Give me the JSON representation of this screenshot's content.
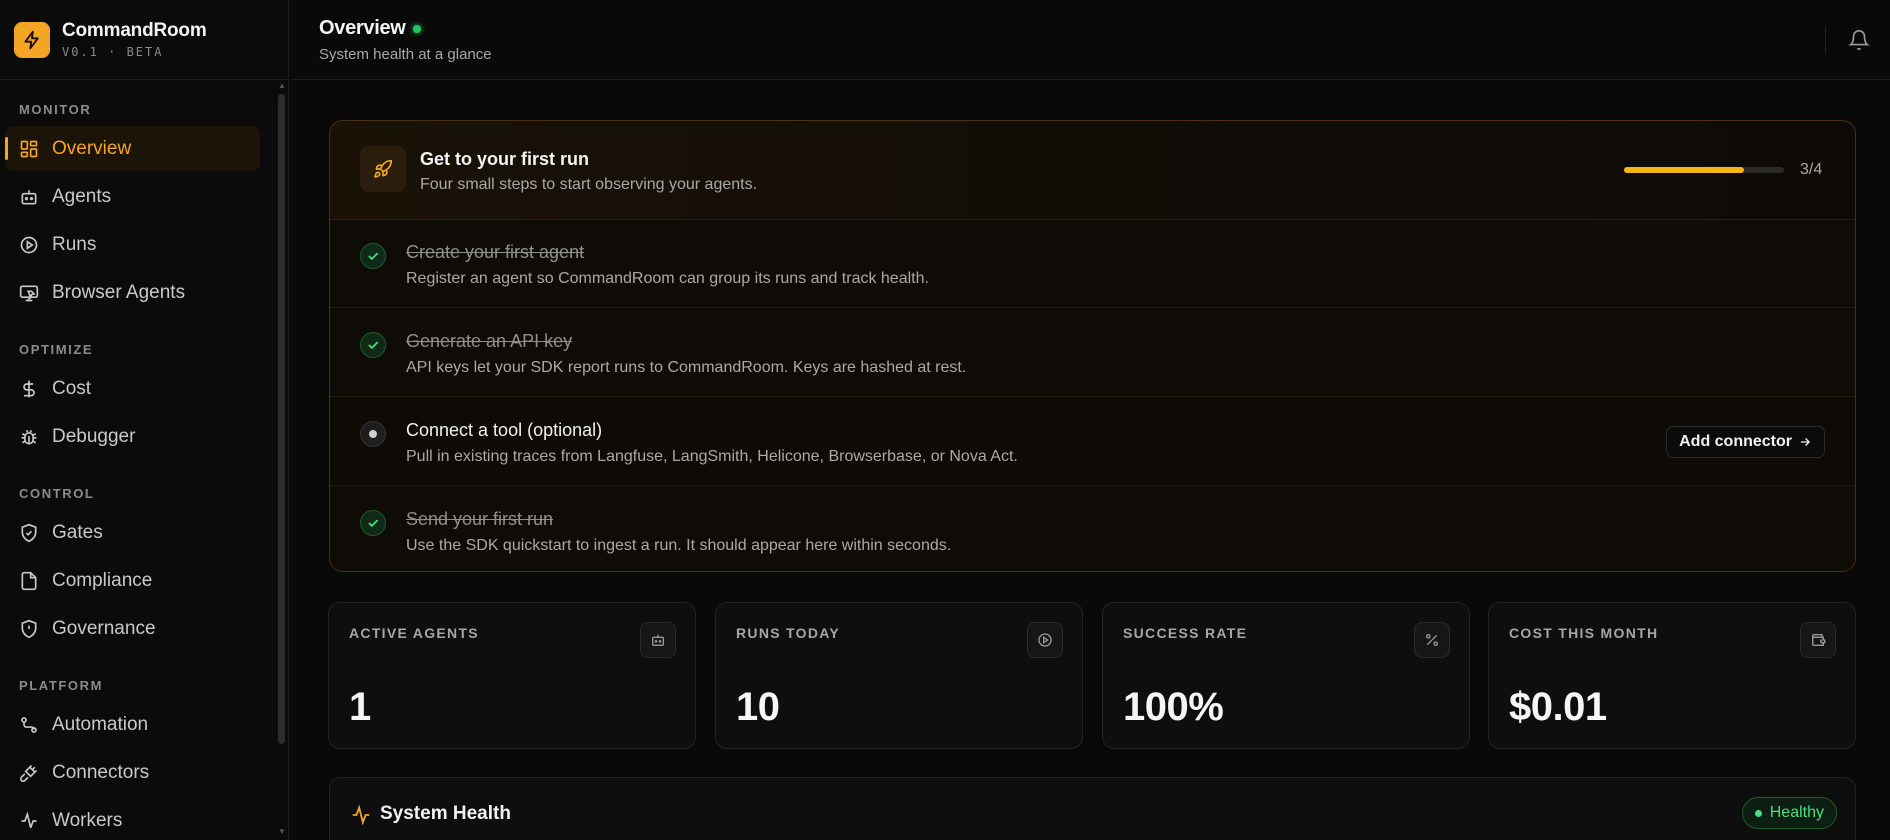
{
  "app": {
    "name": "CommandRoom",
    "version": "V0.1 · BETA"
  },
  "sidebar": {
    "sections": [
      {
        "label": "MONITOR",
        "items": [
          {
            "label": "Overview",
            "icon": "dashboard-icon",
            "active": true
          },
          {
            "label": "Agents",
            "icon": "bot-icon"
          },
          {
            "label": "Runs",
            "icon": "play-circle-icon"
          },
          {
            "label": "Browser Agents",
            "icon": "browser-icon"
          }
        ]
      },
      {
        "label": "OPTIMIZE",
        "items": [
          {
            "label": "Cost",
            "icon": "dollar-icon"
          },
          {
            "label": "Debugger",
            "icon": "bug-icon"
          }
        ]
      },
      {
        "label": "CONTROL",
        "items": [
          {
            "label": "Gates",
            "icon": "shield-check-icon"
          },
          {
            "label": "Compliance",
            "icon": "document-icon"
          },
          {
            "label": "Governance",
            "icon": "shield-alert-icon"
          }
        ]
      },
      {
        "label": "PLATFORM",
        "items": [
          {
            "label": "Automation",
            "icon": "workflow-icon"
          },
          {
            "label": "Connectors",
            "icon": "plug-icon"
          },
          {
            "label": "Workers",
            "icon": "activity-icon"
          }
        ]
      }
    ]
  },
  "header": {
    "title": "Overview",
    "subtitle": "System health at a glance"
  },
  "onboarding": {
    "title": "Get to your first run",
    "subtitle": "Four small steps to start observing your agents.",
    "progress_text": "3/4",
    "progress_fraction": 0.75,
    "steps": [
      {
        "title": "Create your first agent",
        "desc": "Register an agent so CommandRoom can group its runs and track health.",
        "done": true
      },
      {
        "title": "Generate an API key",
        "desc": "API keys let your SDK report runs to CommandRoom. Keys are hashed at rest.",
        "done": true
      },
      {
        "title": "Connect a tool (optional)",
        "desc": "Pull in existing traces from Langfuse, LangSmith, Helicone, Browserbase, or Nova Act.",
        "done": false,
        "action": "Add connector"
      },
      {
        "title": "Send your first run",
        "desc": "Use the SDK quickstart to ingest a run. It should appear here within seconds.",
        "done": true
      }
    ]
  },
  "stats": [
    {
      "label": "ACTIVE AGENTS",
      "value": "1",
      "icon": "bot-icon"
    },
    {
      "label": "RUNS TODAY",
      "value": "10",
      "icon": "play-circle-icon"
    },
    {
      "label": "SUCCESS RATE",
      "value": "100%",
      "icon": "percent-icon"
    },
    {
      "label": "COST THIS MONTH",
      "value": "$0.01",
      "icon": "wallet-icon"
    }
  ],
  "health": {
    "title": "System Health",
    "status": "Healthy"
  },
  "colors": {
    "accent": "#f5a524",
    "success": "#4ade80",
    "background": "#090909"
  }
}
